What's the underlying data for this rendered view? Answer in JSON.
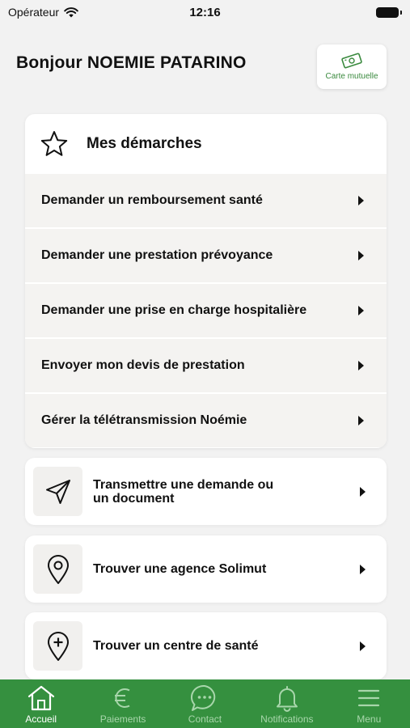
{
  "status": {
    "carrier": "Opérateur",
    "time": "12:16"
  },
  "header": {
    "greeting": "Bonjour NOEMIE PATARINO",
    "card_button_label": "Carte mutuelle"
  },
  "demarches": {
    "title": "Mes démarches",
    "items": [
      {
        "label": "Demander un remboursement santé"
      },
      {
        "label": "Demander une prestation prévoyance"
      },
      {
        "label": "Demander une prise en charge hospitalière"
      },
      {
        "label": "Envoyer mon devis de prestation"
      },
      {
        "label": "Gérer la télétransmission Noémie"
      }
    ]
  },
  "actions": [
    {
      "label": "Transmettre une demande ou\nun document",
      "icon": "send-icon"
    },
    {
      "label": "Trouver une agence Solimut",
      "icon": "location-pin-icon"
    },
    {
      "label": "Trouver un centre de santé",
      "icon": "health-location-icon"
    }
  ],
  "tabbar": {
    "accent": "#35903f",
    "tabs": [
      {
        "label": "Accueil",
        "icon": "home-icon",
        "active": true
      },
      {
        "label": "Paiements",
        "icon": "euro-icon",
        "active": false
      },
      {
        "label": "Contact",
        "icon": "chat-icon",
        "active": false
      },
      {
        "label": "Notifications",
        "icon": "bell-icon",
        "active": false
      },
      {
        "label": "Menu",
        "icon": "menu-icon",
        "active": false
      }
    ]
  }
}
